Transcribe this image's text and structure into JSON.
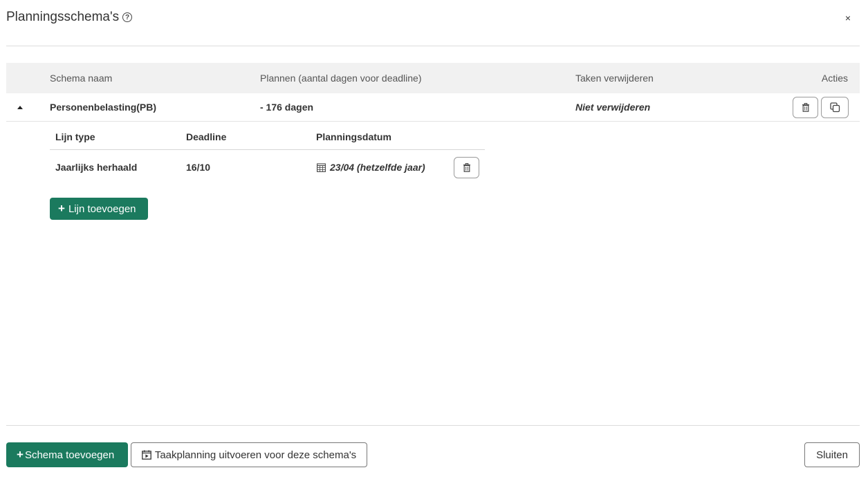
{
  "modal": {
    "title": "Planningsschema's",
    "help_icon": "question-circle-icon",
    "close_label": "×"
  },
  "table": {
    "headers": {
      "name": "Schema naam",
      "plan": "Plannen (aantal dagen voor deadline)",
      "remove": "Taken verwijderen",
      "actions": "Acties"
    },
    "rows": [
      {
        "name": "Personenbelasting(PB)",
        "plan": "- 176 dagen",
        "remove": "Niet verwijderen",
        "expanded": true,
        "sub": {
          "headers": {
            "type": "Lijn type",
            "deadline": "Deadline",
            "date": "Planningsdatum"
          },
          "rows": [
            {
              "type": "Jaarlijks herhaald",
              "deadline": "16/10",
              "date": "23/04 (hetzelfde jaar)"
            }
          ],
          "add_label": "Lijn toevoegen"
        }
      }
    ]
  },
  "footer": {
    "add_schema": "Schema toevoegen",
    "run_planning": "Taakplanning uitvoeren voor deze schema's",
    "close": "Sluiten"
  },
  "colors": {
    "primary": "#1b7a5e",
    "header_bg": "#f1f1f1"
  }
}
